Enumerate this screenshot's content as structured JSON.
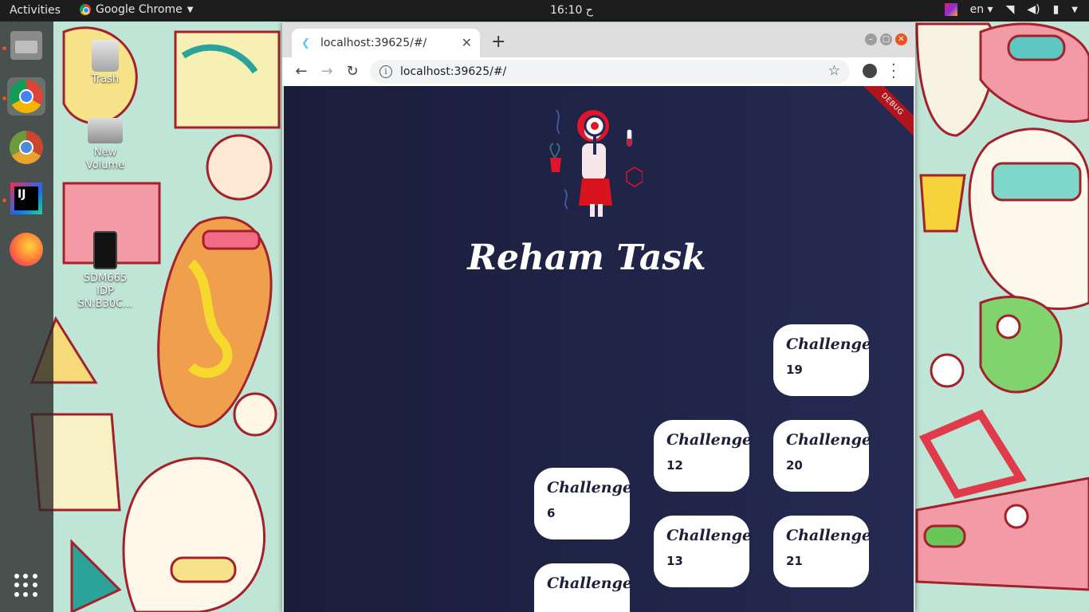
{
  "topbar": {
    "activities": "Activities",
    "app_name": "Google Chrome",
    "clock": "16:10 ح",
    "language": "en"
  },
  "desktop": {
    "icons": [
      {
        "label": "Trash"
      },
      {
        "label": "New Volume"
      },
      {
        "label": "SDM665 IDP SN:B30C..."
      }
    ]
  },
  "browser": {
    "tab_title": "localhost:39625/#/",
    "url": "localhost:39625/#/",
    "new_tab": "+",
    "close_tab": "✕"
  },
  "app": {
    "debug_banner": "DEBUG",
    "title": "Reham Task",
    "challenge_label": "Challenge",
    "cards": [
      {
        "number": "19"
      },
      {
        "number": "12"
      },
      {
        "number": "20"
      },
      {
        "number": "6"
      },
      {
        "number": "13"
      },
      {
        "number": "21"
      },
      {
        "number": ""
      }
    ]
  },
  "colors": {
    "app_background": "#1f2347",
    "card_background": "#ffffff",
    "card_text": "#1d1f3a",
    "debug_banner": "#b0151e",
    "ubuntu_accent": "#e95420"
  }
}
